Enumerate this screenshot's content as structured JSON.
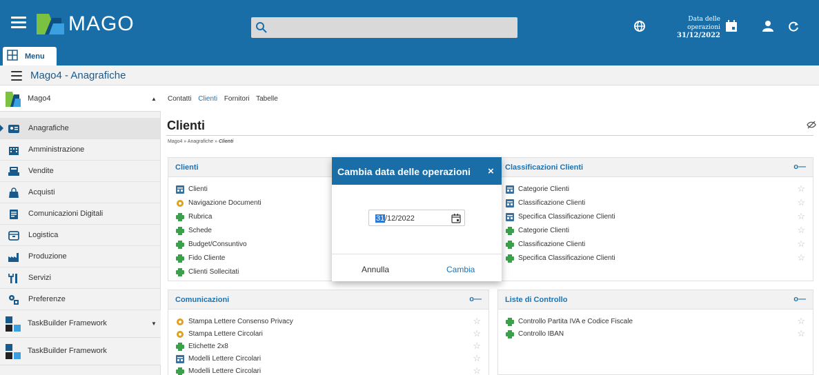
{
  "header": {
    "app_name": "MAGO",
    "date_label": "Data delle operazioni",
    "date_value": "31/12/2022",
    "menu_tab": "Menu"
  },
  "subheader": {
    "title": "Mago4 - Anagrafiche"
  },
  "sidebar": {
    "group_top": "Mago4",
    "items": [
      {
        "label": "Anagrafiche",
        "icon": "contacts-card-icon"
      },
      {
        "label": "Amministrazione",
        "icon": "building-icon"
      },
      {
        "label": "Vendite",
        "icon": "sales-icon"
      },
      {
        "label": "Acquisti",
        "icon": "shopping-bag-icon"
      },
      {
        "label": "Comunicazioni Digitali",
        "icon": "digital-doc-icon"
      },
      {
        "label": "Logistica",
        "icon": "logistics-icon"
      },
      {
        "label": "Produzione",
        "icon": "factory-icon"
      },
      {
        "label": "Servizi",
        "icon": "tools-icon"
      },
      {
        "label": "Preferenze",
        "icon": "preferences-icon"
      }
    ],
    "group_tb1": "TaskBuilder Framework",
    "group_tb2": "TaskBuilder Framework"
  },
  "main": {
    "tabs": [
      "Contatti",
      "Clienti",
      "Fornitori",
      "Tabelle"
    ],
    "title": "Clienti",
    "breadcrumb_prefix": "Mago4 » Anagrafiche » ",
    "breadcrumb_current": "Clienti",
    "cards": {
      "clienti": {
        "title": "Clienti",
        "rows": [
          "Clienti",
          "Navigazione Documenti",
          "Rubrica",
          "Schede",
          "Budget/Consuntivo",
          "Fido Cliente",
          "Clienti Sollecitati"
        ]
      },
      "classificazioni": {
        "title": "Classificazioni Clienti",
        "menu": "o—",
        "rows": [
          "Categorie Clienti",
          "Classificazione Clienti",
          "Specifica Classificazione Clienti",
          "Categorie Clienti",
          "Classificazione Clienti",
          "Specifica Classificazione Clienti"
        ]
      },
      "comunicazioni": {
        "title": "Comunicazioni",
        "menu": "o—",
        "rows": [
          "Stampa Lettere Consenso Privacy",
          "Stampa Lettere Circolari",
          "Etichette 2x8",
          "Modelli Lettere Circolari",
          "Modelli Lettere Circolari"
        ]
      },
      "liste": {
        "title": "Liste di Controllo",
        "menu": "o—",
        "rows": [
          "Controllo Partita IVA e Codice Fiscale",
          "Controllo IBAN"
        ]
      }
    }
  },
  "dialog": {
    "title": "Cambia data delle operazioni",
    "close": "×",
    "date_day": "31",
    "date_rest": "/12/2022",
    "cancel": "Annulla",
    "confirm": "Cambia"
  },
  "colors": {
    "brand": "#1a6ea8",
    "link": "#1a73b5",
    "report": "#3aa04a",
    "doc": "#e0a020",
    "table": "#3a70a0"
  }
}
